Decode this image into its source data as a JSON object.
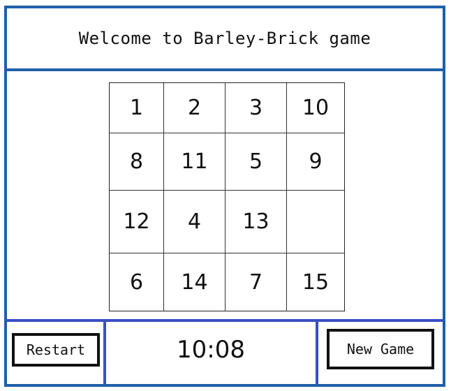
{
  "header": {
    "title": "Welcome to Barley-Brick game"
  },
  "board": {
    "tiles": [
      [
        "1",
        "2",
        "3",
        "10"
      ],
      [
        "8",
        "11",
        "5",
        "9"
      ],
      [
        "12",
        "4",
        "13",
        ""
      ],
      [
        "6",
        "14",
        "7",
        "15"
      ]
    ]
  },
  "footer": {
    "restart_label": "Restart",
    "timer": "10:08",
    "new_game_label": "New Game"
  },
  "colors": {
    "frame": "#1f5fa8",
    "footer_border": "#3a4fc4"
  }
}
